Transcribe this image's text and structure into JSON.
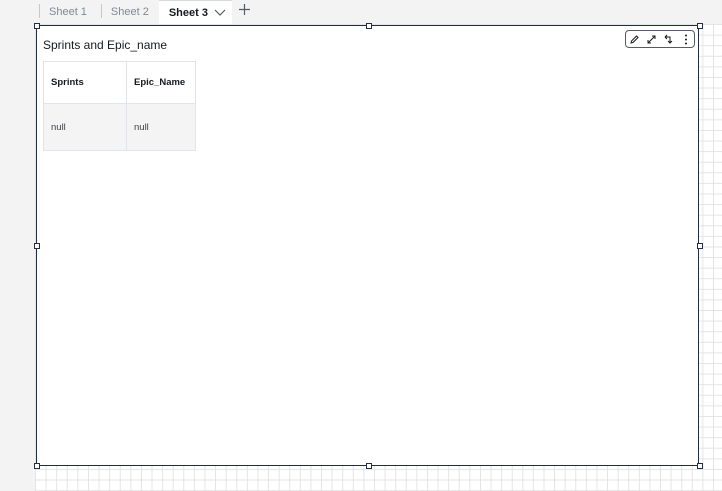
{
  "tabs": [
    {
      "label": "Sheet 1",
      "active": false
    },
    {
      "label": "Sheet 2",
      "active": false
    },
    {
      "label": "Sheet 3",
      "active": true
    }
  ],
  "add_tab_icon": "plus-icon",
  "visual": {
    "title": "Sprints and Epic_name",
    "toolbar_icons": [
      "pencil-icon",
      "expand-icon",
      "swap-icon",
      "more-vertical-icon"
    ],
    "table": {
      "headers": [
        "Sprints",
        "Epic_Name"
      ],
      "rows": [
        [
          "null",
          "null"
        ]
      ]
    }
  }
}
